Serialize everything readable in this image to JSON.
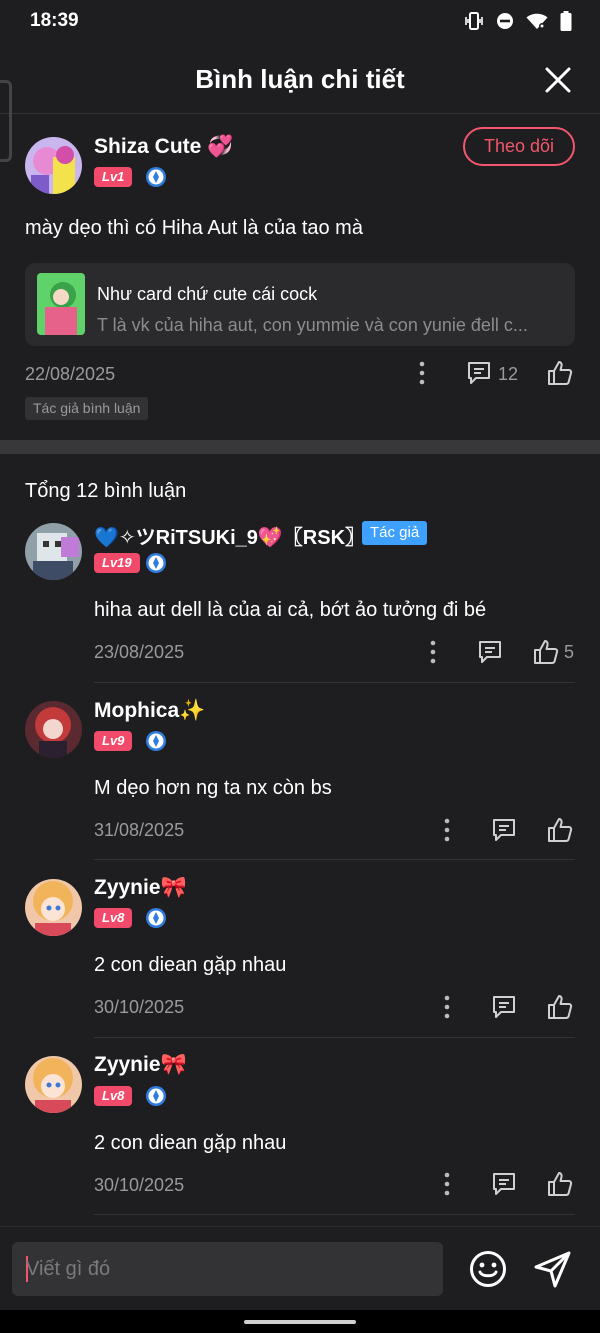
{
  "status_bar": {
    "time": "18:39"
  },
  "header": {
    "title": "Bình luận chi tiết"
  },
  "post": {
    "username": "Shiza Cute 💞",
    "level": "Lv1",
    "follow_label": "Theo dõi",
    "text": "mày dẹo thì có Hiha Aut là của tao mà",
    "quote": {
      "title": "Như card chứ cute cái cock",
      "subtitle": "T là vk của hiha aut, con yummie và con yunie đell c..."
    },
    "date": "22/08/2025",
    "reply_count": "12",
    "tag": "Tác giả bình luận"
  },
  "comments_header": {
    "total": "Tổng 12 bình luận"
  },
  "comments": [
    {
      "username": "💙✧ツRiTSUKi_9💖〖RSK〗",
      "author_tag": "Tác giả",
      "level": "Lv19",
      "text": "hiha aut dell là của ai cả, bớt ảo tưởng đi bé",
      "date": "23/08/2025",
      "like_count": "5"
    },
    {
      "username": "Mophica✨",
      "level": "Lv9",
      "text": "M dẹo hơn ng ta nx còn bs",
      "date": "31/08/2025"
    },
    {
      "username": "Zyynie🎀",
      "level": "Lv8",
      "text": "2 con diean gặp nhau",
      "date": "30/10/2025"
    },
    {
      "username": "Zyynie🎀",
      "level": "Lv8",
      "text": "2 con diean gặp nhau",
      "date": "30/10/2025"
    }
  ],
  "input": {
    "placeholder": "Viết gì đó"
  }
}
